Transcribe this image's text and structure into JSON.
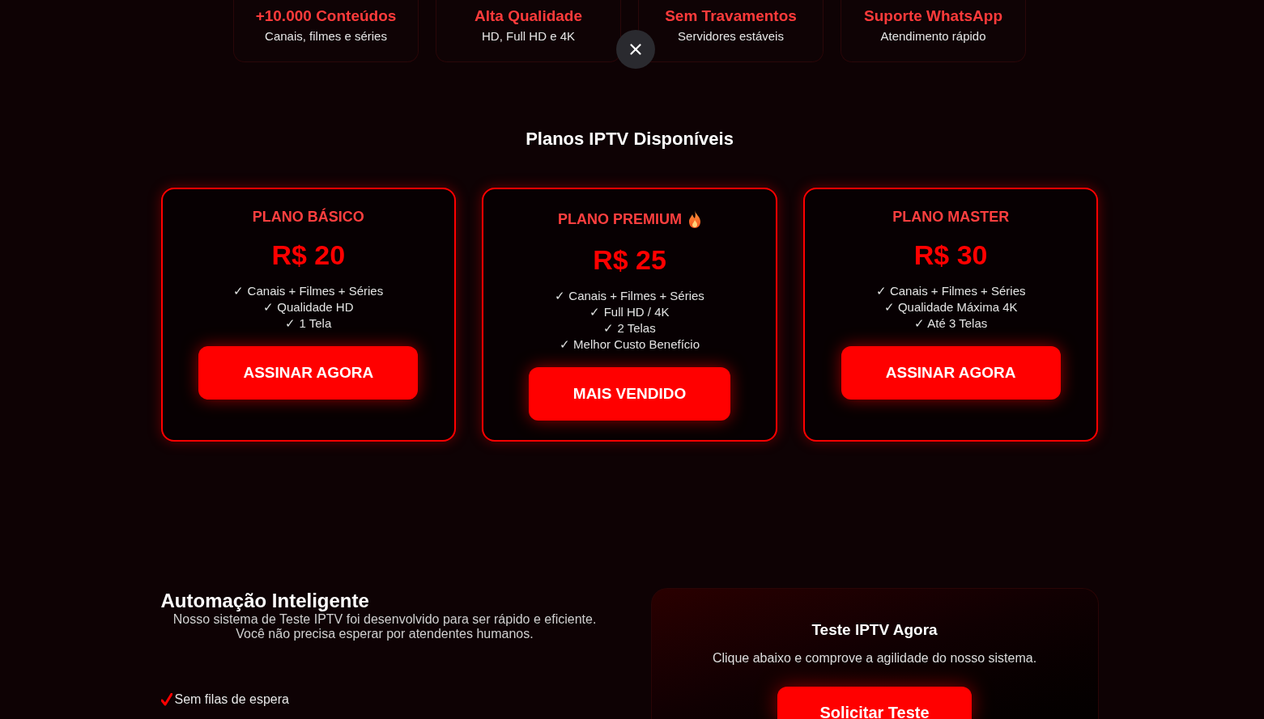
{
  "features": [
    {
      "title": "+10.000 Conteúdos",
      "subtitle": "Canais, filmes e séries"
    },
    {
      "title": "Alta Qualidade",
      "subtitle": "HD, Full HD e 4K"
    },
    {
      "title": "Sem Travamentos",
      "subtitle": "Servidores estáveis"
    },
    {
      "title": "Suporte WhatsApp",
      "subtitle": "Atendimento rápido"
    }
  ],
  "plans_section": {
    "title": "Planos IPTV Disponíveis",
    "plans": [
      {
        "name": "PLANO BÁSICO",
        "featured": false,
        "price": "R$ 20",
        "features": [
          "✓ Canais + Filmes + Séries",
          "✓ Qualidade HD",
          "✓ 1 Tela"
        ],
        "button": "ASSINAR AGORA"
      },
      {
        "name": "PLANO PREMIUM",
        "featured": true,
        "price": "R$ 25",
        "features": [
          "✓ Canais + Filmes + Séries",
          "✓ Full HD / 4K",
          "✓ 2 Telas",
          "✓ Melhor Custo Benefício"
        ],
        "button": "MAIS VENDIDO"
      },
      {
        "name": "PLANO MASTER",
        "featured": false,
        "price": "R$ 30",
        "features": [
          "✓ Canais + Filmes + Séries",
          "✓ Qualidade Máxima 4K",
          "✓ Até 3 Telas"
        ],
        "button": "ASSINAR AGORA"
      }
    ]
  },
  "automation": {
    "title": "Automação Inteligente",
    "description": "Nosso sistema de Teste IPTV foi desenvolvido para ser rápido e eficiente. Você não precisa esperar por atendentes humanos.",
    "benefits": [
      "Sem filas de espera"
    ]
  },
  "trial_card": {
    "title": "Teste IPTV Agora",
    "text": "Clique abaixo e comprove a agilidade do nosso sistema.",
    "button": "Solicitar Teste"
  }
}
